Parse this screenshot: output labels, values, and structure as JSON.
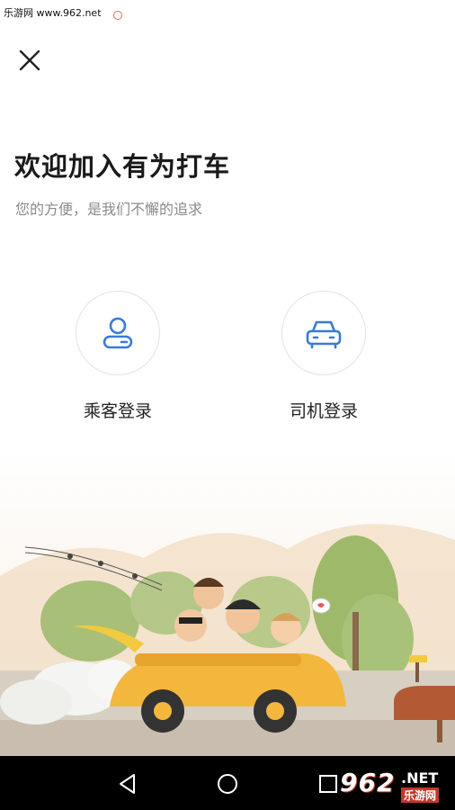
{
  "status_bar": {
    "watermark": "乐游网 www.962.net"
  },
  "header": {
    "close_icon": "close-icon"
  },
  "welcome": {
    "title": "欢迎加入有为打车",
    "subtitle": "您的方便，是我们不懈的追求"
  },
  "login": {
    "passenger": {
      "label": "乘客登录",
      "icon": "passenger-icon"
    },
    "driver": {
      "label": "司机登录",
      "icon": "car-icon"
    }
  },
  "colors": {
    "accent": "#3a7bd5",
    "car": "#f4b73e"
  },
  "nav": {
    "back": "back-icon",
    "home": "home-icon",
    "recents": "recents-icon"
  },
  "watermark_logo": {
    "number": "962",
    "suffix": ".NET",
    "site_name": "乐游网"
  }
}
